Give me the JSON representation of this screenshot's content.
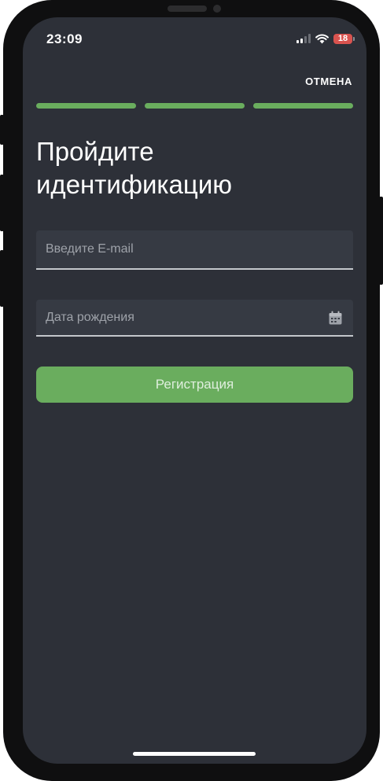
{
  "status_bar": {
    "time": "23:09",
    "battery": "18",
    "battery_color": "#d9534f",
    "icons": [
      "signal-icon",
      "wifi-icon",
      "battery-icon"
    ]
  },
  "header": {
    "cancel_label": "ОТМЕНА"
  },
  "progress": {
    "steps_total": 3,
    "steps_completed": 3,
    "color": "#6aad5e"
  },
  "main": {
    "title": "Пройдите идентификацию",
    "email": {
      "value": "",
      "placeholder": "Введите E-mail"
    },
    "birthdate": {
      "value": "",
      "placeholder": "Дата рождения",
      "icon": "calendar-icon"
    },
    "register_label": "Регистрация"
  },
  "theme": {
    "background": "#2d3038",
    "field_background": "#363a43",
    "accent": "#6aad5e"
  }
}
